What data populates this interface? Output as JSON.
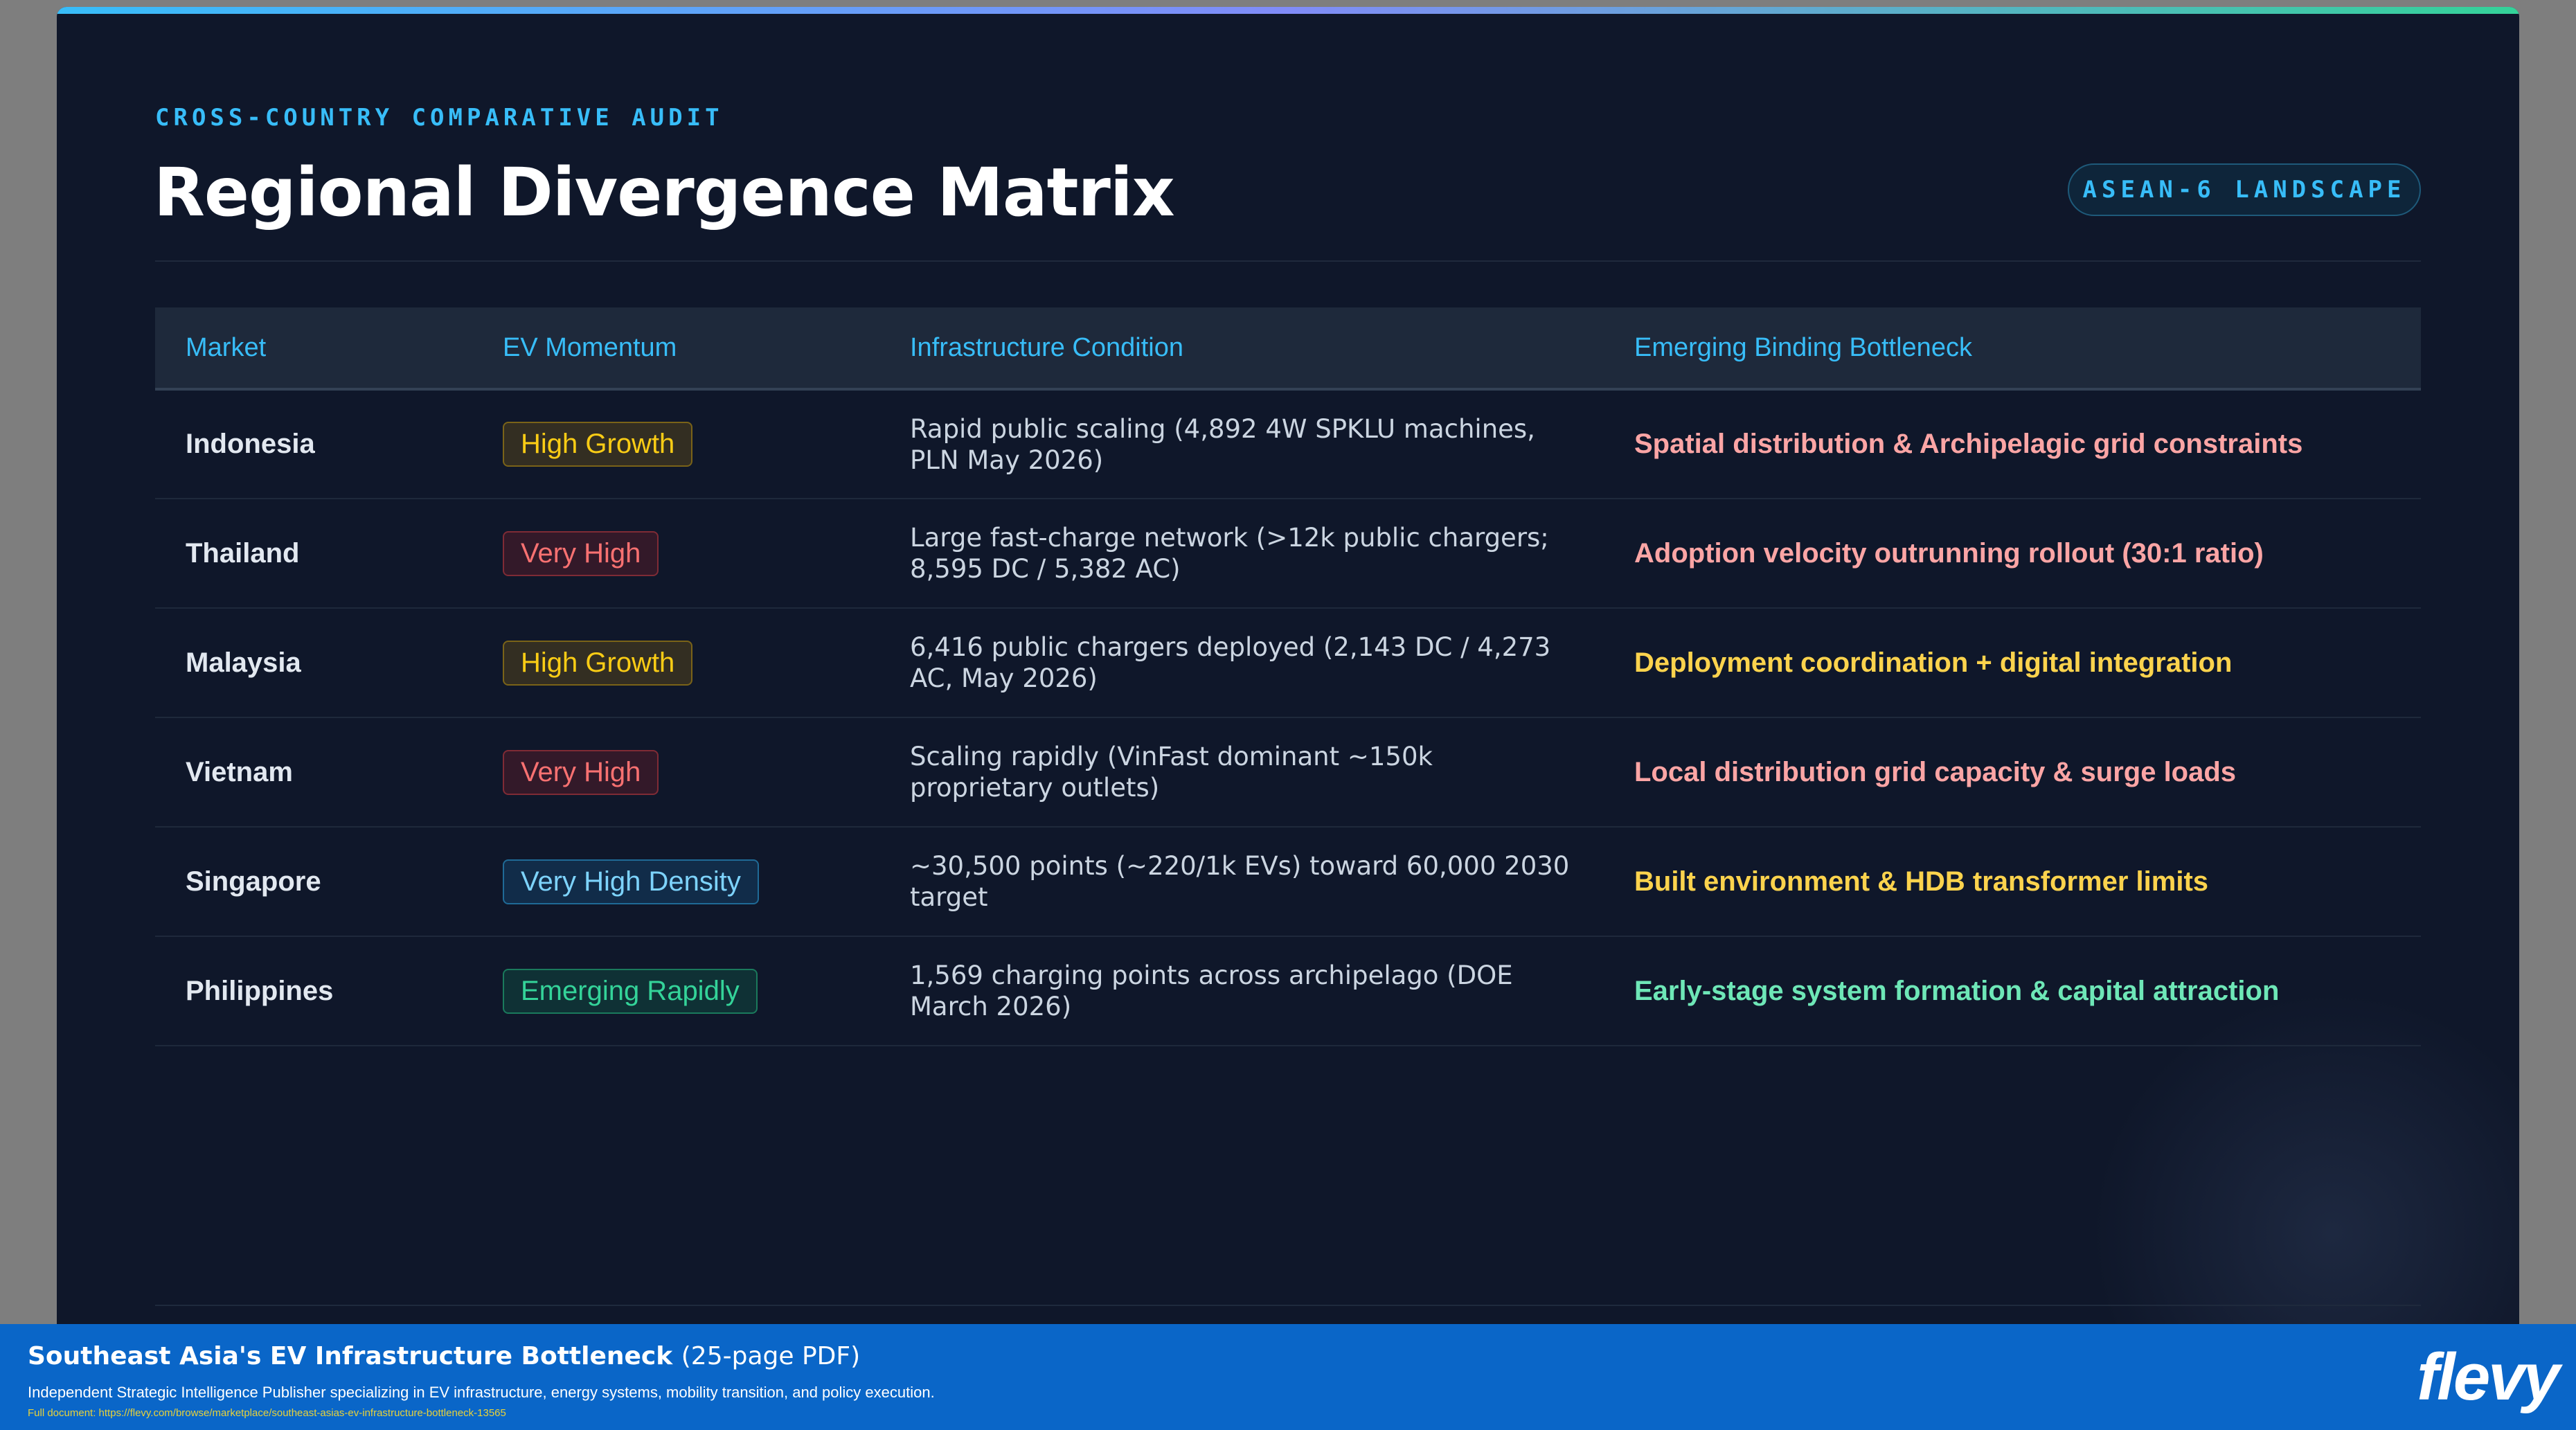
{
  "slide": {
    "eyebrow": "CROSS-COUNTRY COMPARATIVE AUDIT",
    "title": "Regional Divergence Matrix",
    "badge": "ASEAN-6 LANDSCAPE"
  },
  "table": {
    "headers": [
      "Market",
      "EV Momentum",
      "Infrastructure Condition",
      "Emerging Binding Bottleneck"
    ],
    "rows": [
      {
        "market": "Indonesia",
        "momentum": "High Growth",
        "momentum_color": "#facc15",
        "infrastructure": "Rapid public scaling (4,892 4W SPKLU machines, PLN May 2026)",
        "bottleneck": "Spatial distribution & Archipelagic grid constraints",
        "bottleneck_color": "#fca5a5"
      },
      {
        "market": "Thailand",
        "momentum": "Very High",
        "momentum_color": "#f87171",
        "infrastructure": "Large fast-charge network (>12k public chargers; 8,595 DC / 5,382 AC)",
        "bottleneck": "Adoption velocity outrunning rollout (30:1 ratio)",
        "bottleneck_color": "#fca5a5"
      },
      {
        "market": "Malaysia",
        "momentum": "High Growth",
        "momentum_color": "#facc15",
        "infrastructure": "6,416 public chargers deployed (2,143 DC / 4,273 AC, May 2026)",
        "bottleneck": "Deployment coordination + digital integration",
        "bottleneck_color": "#fcd34d"
      },
      {
        "market": "Vietnam",
        "momentum": "Very High",
        "momentum_color": "#f87171",
        "infrastructure": "Scaling rapidly (VinFast dominant ~150k proprietary outlets)",
        "bottleneck": "Local distribution grid capacity & surge loads",
        "bottleneck_color": "#fca5a5"
      },
      {
        "market": "Singapore",
        "momentum": "Very High Density",
        "momentum_color": "#7dd3fc",
        "infrastructure": "~30,500 points (~220/1k EVs) toward 60,000 2030 target",
        "bottleneck": "Built environment & HDB transformer limits",
        "bottleneck_color": "#fcd34d"
      },
      {
        "market": "Philippines",
        "momentum": "Emerging Rapidly",
        "momentum_color": "#34d399",
        "infrastructure": "1,569 charging points across archipelago (DOE March 2026)",
        "bottleneck": "Early-stage system formation & capital attraction",
        "bottleneck_color": "#6ee7b7"
      }
    ]
  },
  "footer": {
    "title": "Southeast Asia's EV Infrastructure Bottleneck",
    "pages": "(25-page PDF)",
    "description": "Independent Strategic Intelligence Publisher specializing in EV infrastructure, energy systems, mobility transition, and policy execution.",
    "link": "Full document: https://flevy.com/browse/marketplace/southeast-asias-ev-infrastructure-bottleneck-13565",
    "logo": "flevy"
  }
}
